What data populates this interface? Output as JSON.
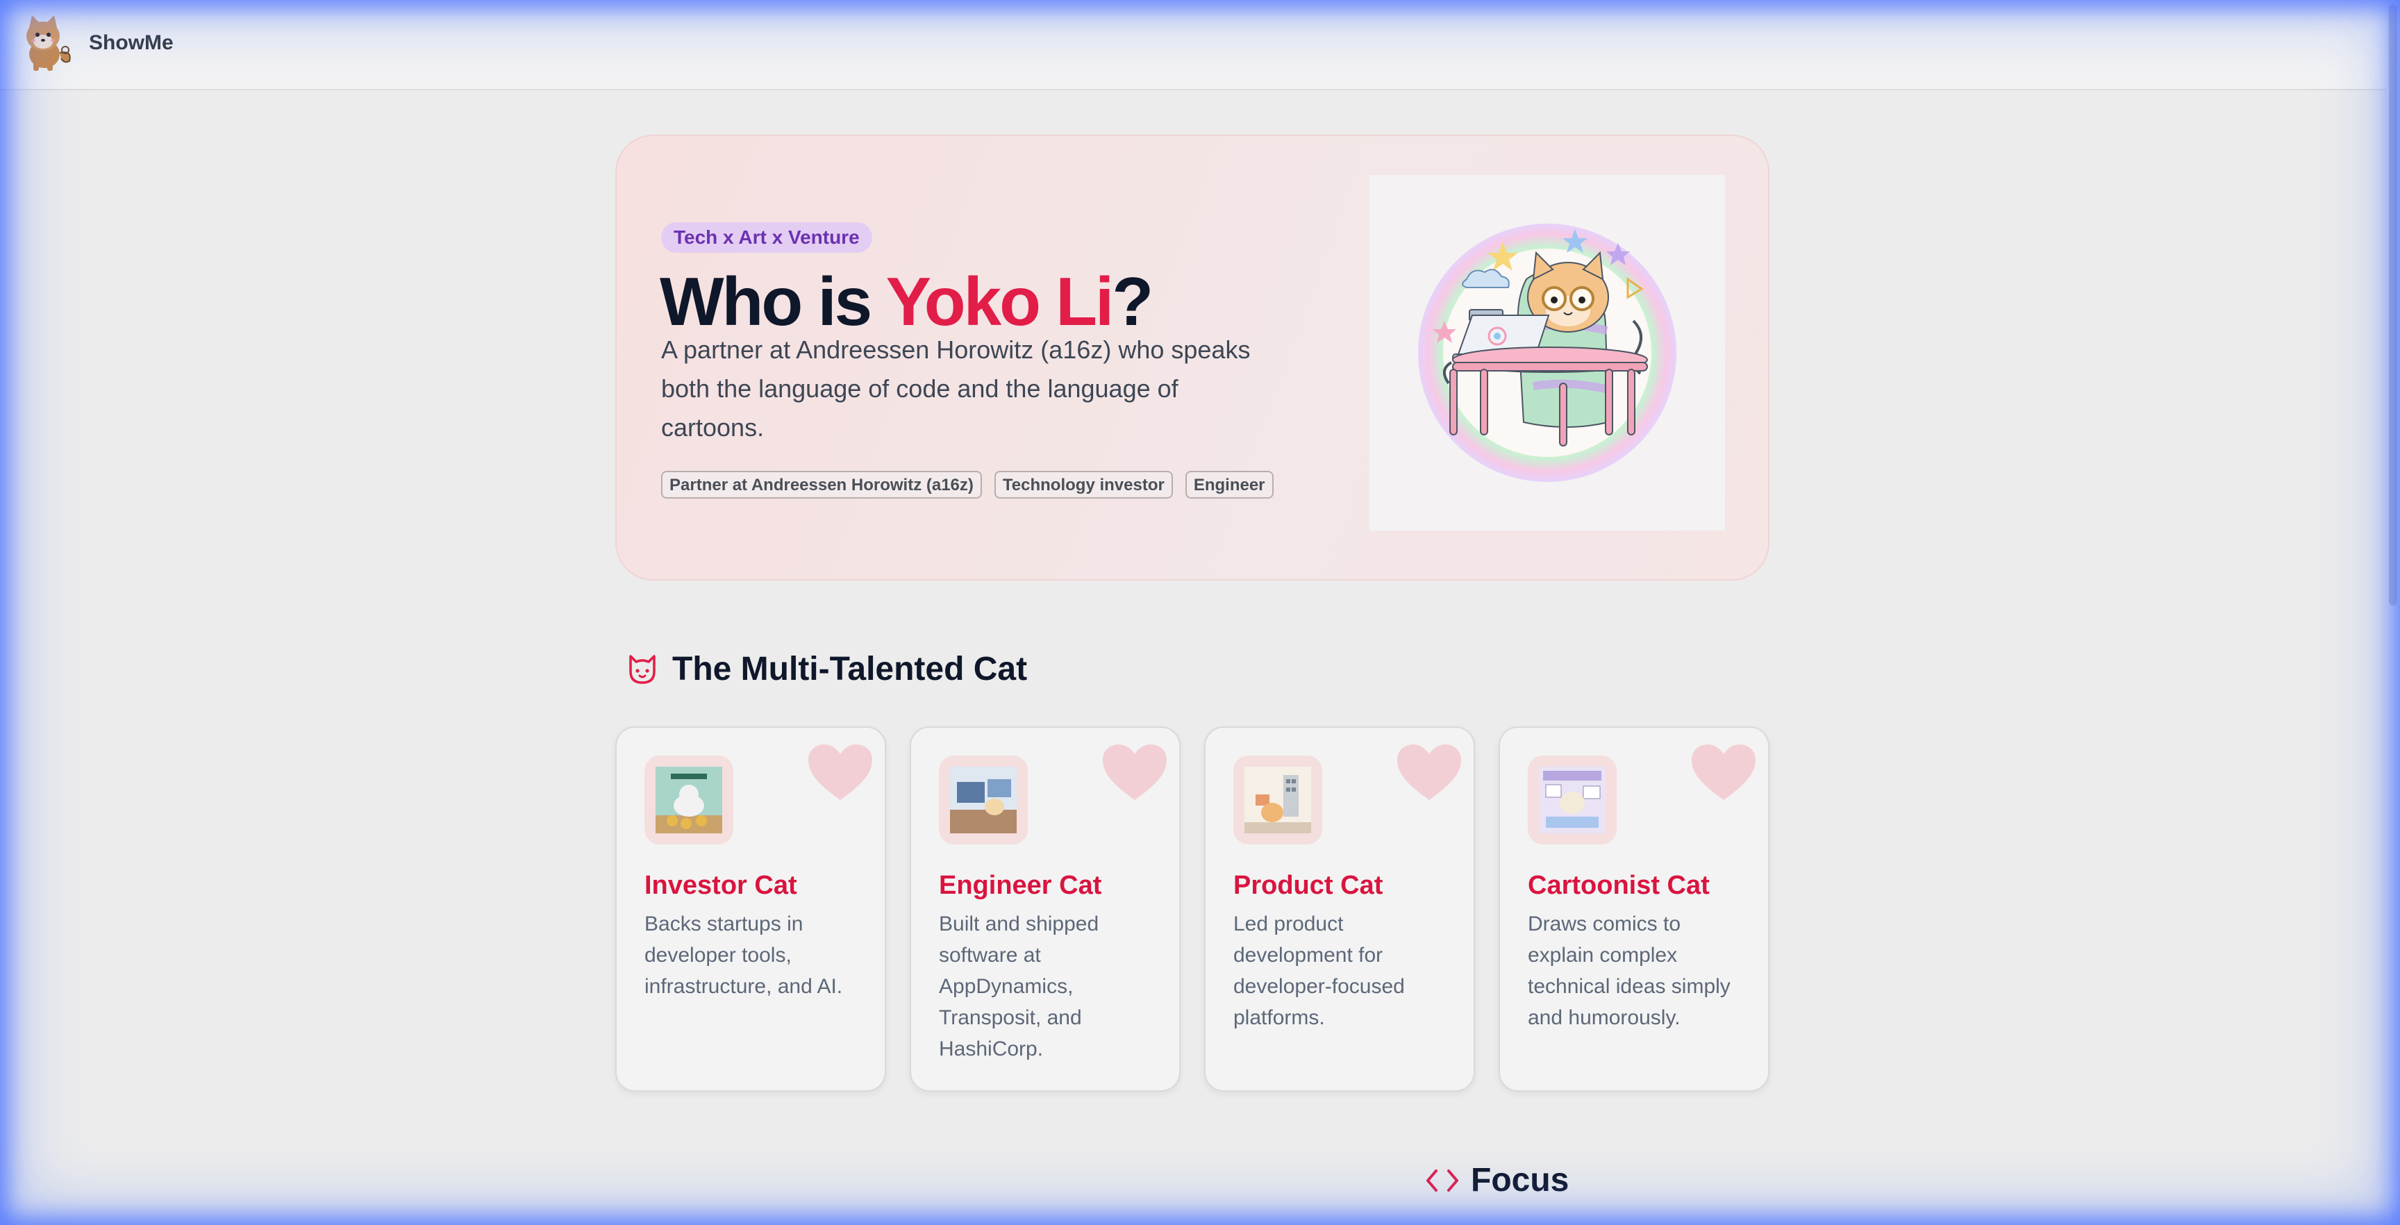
{
  "app": {
    "name": "ShowMe"
  },
  "hero": {
    "tagline": "Tech x Art x Venture",
    "title_prefix": "Who is ",
    "title_highlight": "Yoko Li",
    "title_suffix": "?",
    "description": "A partner at Andreessen Horowitz (a16z) who speaks both the language of code and the language of cartoons.",
    "roles": [
      "Partner at Andreessen Horowitz (a16z)",
      "Technology investor",
      "Engineer"
    ]
  },
  "section": {
    "title": "The Multi-Talented Cat",
    "cards": [
      {
        "title": "Investor Cat",
        "description": "Backs startups in developer tools, infrastructure, and AI."
      },
      {
        "title": "Engineer Cat",
        "description": "Built and shipped software at AppDynamics, Transposit, and HashiCorp."
      },
      {
        "title": "Product Cat",
        "description": "Led product development for developer-focused platforms."
      },
      {
        "title": "Cartoonist Cat",
        "description": "Draws comics to explain complex technical ideas simply and humorously."
      }
    ]
  },
  "focus": {
    "title": "Focus"
  },
  "colors": {
    "accent": "#e11d48",
    "tag_bg": "#e4cdf3",
    "tag_text": "#6b32b0",
    "card_title": "#d9143f"
  }
}
